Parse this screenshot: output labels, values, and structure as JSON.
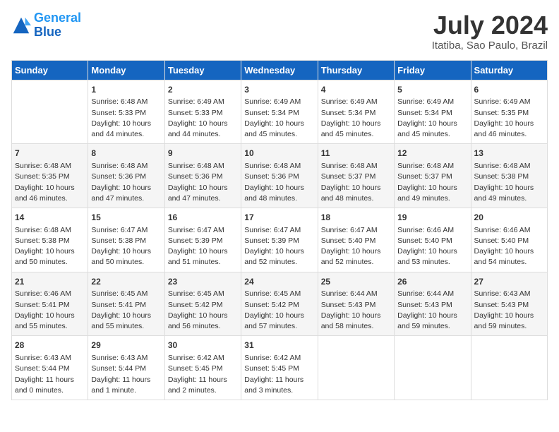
{
  "header": {
    "logo_line1": "General",
    "logo_line2": "Blue",
    "title": "July 2024",
    "subtitle": "Itatiba, Sao Paulo, Brazil"
  },
  "calendar": {
    "days_of_week": [
      "Sunday",
      "Monday",
      "Tuesday",
      "Wednesday",
      "Thursday",
      "Friday",
      "Saturday"
    ],
    "weeks": [
      [
        {
          "date": "",
          "info": ""
        },
        {
          "date": "1",
          "info": "Sunrise: 6:48 AM\nSunset: 5:33 PM\nDaylight: 10 hours\nand 44 minutes."
        },
        {
          "date": "2",
          "info": "Sunrise: 6:49 AM\nSunset: 5:33 PM\nDaylight: 10 hours\nand 44 minutes."
        },
        {
          "date": "3",
          "info": "Sunrise: 6:49 AM\nSunset: 5:34 PM\nDaylight: 10 hours\nand 45 minutes."
        },
        {
          "date": "4",
          "info": "Sunrise: 6:49 AM\nSunset: 5:34 PM\nDaylight: 10 hours\nand 45 minutes."
        },
        {
          "date": "5",
          "info": "Sunrise: 6:49 AM\nSunset: 5:34 PM\nDaylight: 10 hours\nand 45 minutes."
        },
        {
          "date": "6",
          "info": "Sunrise: 6:49 AM\nSunset: 5:35 PM\nDaylight: 10 hours\nand 46 minutes."
        }
      ],
      [
        {
          "date": "7",
          "info": "Sunrise: 6:48 AM\nSunset: 5:35 PM\nDaylight: 10 hours\nand 46 minutes."
        },
        {
          "date": "8",
          "info": "Sunrise: 6:48 AM\nSunset: 5:36 PM\nDaylight: 10 hours\nand 47 minutes."
        },
        {
          "date": "9",
          "info": "Sunrise: 6:48 AM\nSunset: 5:36 PM\nDaylight: 10 hours\nand 47 minutes."
        },
        {
          "date": "10",
          "info": "Sunrise: 6:48 AM\nSunset: 5:36 PM\nDaylight: 10 hours\nand 48 minutes."
        },
        {
          "date": "11",
          "info": "Sunrise: 6:48 AM\nSunset: 5:37 PM\nDaylight: 10 hours\nand 48 minutes."
        },
        {
          "date": "12",
          "info": "Sunrise: 6:48 AM\nSunset: 5:37 PM\nDaylight: 10 hours\nand 49 minutes."
        },
        {
          "date": "13",
          "info": "Sunrise: 6:48 AM\nSunset: 5:38 PM\nDaylight: 10 hours\nand 49 minutes."
        }
      ],
      [
        {
          "date": "14",
          "info": "Sunrise: 6:48 AM\nSunset: 5:38 PM\nDaylight: 10 hours\nand 50 minutes."
        },
        {
          "date": "15",
          "info": "Sunrise: 6:47 AM\nSunset: 5:38 PM\nDaylight: 10 hours\nand 50 minutes."
        },
        {
          "date": "16",
          "info": "Sunrise: 6:47 AM\nSunset: 5:39 PM\nDaylight: 10 hours\nand 51 minutes."
        },
        {
          "date": "17",
          "info": "Sunrise: 6:47 AM\nSunset: 5:39 PM\nDaylight: 10 hours\nand 52 minutes."
        },
        {
          "date": "18",
          "info": "Sunrise: 6:47 AM\nSunset: 5:40 PM\nDaylight: 10 hours\nand 52 minutes."
        },
        {
          "date": "19",
          "info": "Sunrise: 6:46 AM\nSunset: 5:40 PM\nDaylight: 10 hours\nand 53 minutes."
        },
        {
          "date": "20",
          "info": "Sunrise: 6:46 AM\nSunset: 5:40 PM\nDaylight: 10 hours\nand 54 minutes."
        }
      ],
      [
        {
          "date": "21",
          "info": "Sunrise: 6:46 AM\nSunset: 5:41 PM\nDaylight: 10 hours\nand 55 minutes."
        },
        {
          "date": "22",
          "info": "Sunrise: 6:45 AM\nSunset: 5:41 PM\nDaylight: 10 hours\nand 55 minutes."
        },
        {
          "date": "23",
          "info": "Sunrise: 6:45 AM\nSunset: 5:42 PM\nDaylight: 10 hours\nand 56 minutes."
        },
        {
          "date": "24",
          "info": "Sunrise: 6:45 AM\nSunset: 5:42 PM\nDaylight: 10 hours\nand 57 minutes."
        },
        {
          "date": "25",
          "info": "Sunrise: 6:44 AM\nSunset: 5:43 PM\nDaylight: 10 hours\nand 58 minutes."
        },
        {
          "date": "26",
          "info": "Sunrise: 6:44 AM\nSunset: 5:43 PM\nDaylight: 10 hours\nand 59 minutes."
        },
        {
          "date": "27",
          "info": "Sunrise: 6:43 AM\nSunset: 5:43 PM\nDaylight: 10 hours\nand 59 minutes."
        }
      ],
      [
        {
          "date": "28",
          "info": "Sunrise: 6:43 AM\nSunset: 5:44 PM\nDaylight: 11 hours\nand 0 minutes."
        },
        {
          "date": "29",
          "info": "Sunrise: 6:43 AM\nSunset: 5:44 PM\nDaylight: 11 hours\nand 1 minute."
        },
        {
          "date": "30",
          "info": "Sunrise: 6:42 AM\nSunset: 5:45 PM\nDaylight: 11 hours\nand 2 minutes."
        },
        {
          "date": "31",
          "info": "Sunrise: 6:42 AM\nSunset: 5:45 PM\nDaylight: 11 hours\nand 3 minutes."
        },
        {
          "date": "",
          "info": ""
        },
        {
          "date": "",
          "info": ""
        },
        {
          "date": "",
          "info": ""
        }
      ]
    ]
  }
}
